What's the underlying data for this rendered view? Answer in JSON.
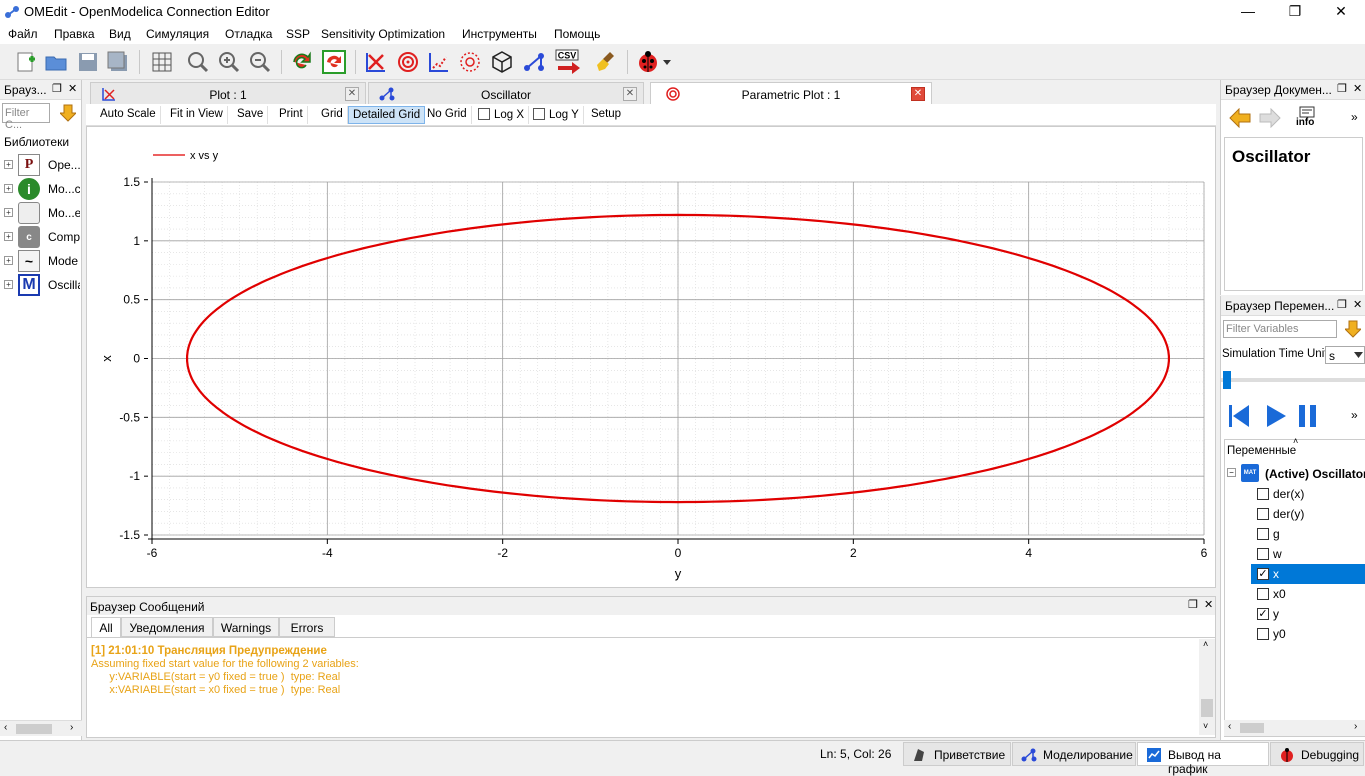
{
  "window": {
    "title": "OMEdit - OpenModelica Connection Editor",
    "min": "—",
    "max": "❐",
    "close": "✕"
  },
  "menu": [
    "Файл",
    "Правка",
    "Вид",
    "Симуляция",
    "Отладка",
    "SSP",
    "Sensitivity Optimization",
    "Инструменты",
    "Помощь"
  ],
  "toolbar": {
    "csv_label": "CSV"
  },
  "left_dock": {
    "title": "Брауз...",
    "filter_placeholder": "Filter C...",
    "section": "Библиотеки",
    "items": [
      {
        "label": "Ope...",
        "icon": "P"
      },
      {
        "label": "Mo...c",
        "icon": "i"
      },
      {
        "label": "Mo...e",
        "icon": ""
      },
      {
        "label": "Comp",
        "icon": "c"
      },
      {
        "label": "Mode",
        "icon": "~"
      },
      {
        "label": "Oscilla",
        "icon": "M"
      }
    ]
  },
  "tabs": [
    {
      "label": "Plot : 1",
      "close": "✕"
    },
    {
      "label": "Oscillator",
      "close": "✕"
    },
    {
      "label": "Parametric Plot : 1",
      "close": "✕"
    }
  ],
  "plot_toolbar": {
    "auto_scale": "Auto Scale",
    "fit_in_view": "Fit in View",
    "save": "Save",
    "print": "Print",
    "grid": "Grid",
    "detailed_grid": "Detailed Grid",
    "no_grid": "No Grid",
    "log_x": "Log X",
    "log_y": "Log Y",
    "setup": "Setup"
  },
  "chart_data": {
    "type": "line",
    "legend": "x vs y",
    "legend_position": "top-left",
    "xlabel": "y",
    "ylabel": "x",
    "xlim": [
      -6,
      6
    ],
    "ylim": [
      -1.5,
      1.5
    ],
    "xticks": [
      "-6",
      "-4",
      "-2",
      "0",
      "2",
      "4",
      "6"
    ],
    "yticks": [
      "1.5",
      "1",
      "0.5",
      "0",
      "-0.5",
      "-1",
      "-1.5"
    ],
    "grid": "detailed",
    "series_color": "#e00000",
    "curve": {
      "shape": "ellipse",
      "x_amplitude": 5.6,
      "y_amplitude": 1.22
    }
  },
  "messages": {
    "title": "Браузер Сообщений",
    "tabs": [
      "All",
      "Уведомления",
      "Warnings",
      "Errors"
    ],
    "header": "[1] 21:01:10 Трансляция Предупреждение",
    "lines": [
      "Assuming fixed start value for the following 2 variables:",
      "      y:VARIABLE(start = y0 fixed = true )  type: Real",
      "      x:VARIABLE(start = x0 fixed = true )  type: Real"
    ]
  },
  "doc_browser": {
    "title": "Браузер Докумен...",
    "info_label": "info",
    "heading": "Oscillator"
  },
  "var_browser": {
    "title": "Браузер Перемен...",
    "filter_placeholder": "Filter Variables",
    "sim_time_unit_label": "Simulation Time Unit",
    "sim_time_unit_value": "s",
    "variables_header": "Переменные",
    "root": "(Active) Oscillator",
    "root_icon": "MAT",
    "variables": [
      {
        "name": "der(x)",
        "checked": false
      },
      {
        "name": "der(y)",
        "checked": false
      },
      {
        "name": "g",
        "checked": false
      },
      {
        "name": "w",
        "checked": false
      },
      {
        "name": "x",
        "checked": true,
        "selected": true
      },
      {
        "name": "x0",
        "checked": false
      },
      {
        "name": "y",
        "checked": true
      },
      {
        "name": "y0",
        "checked": false
      }
    ]
  },
  "status": {
    "position": "Ln: 5, Col: 26",
    "tabs": [
      "Приветствие",
      "Моделирование",
      "Вывод на график",
      "Debugging"
    ]
  }
}
